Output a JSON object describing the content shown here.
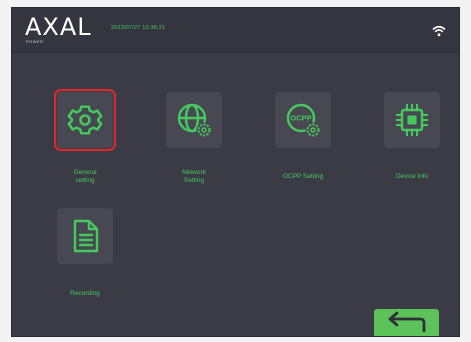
{
  "header": {
    "logo": "AXAL",
    "logo_sub": "POWER",
    "datetime": "2023/07/27 10:38:21",
    "wifi_icon": "wifi-icon"
  },
  "menu": {
    "items": [
      {
        "label": "General\nsetting",
        "icon": "gear-icon",
        "selected": true
      },
      {
        "label": "Network\nSetting",
        "icon": "globe-gear-icon",
        "selected": false
      },
      {
        "label": "OCPP Setting",
        "icon": "ocpp-gear-icon",
        "selected": false
      },
      {
        "label": "Device Info",
        "icon": "chip-icon",
        "selected": false
      },
      {
        "label": "Recording",
        "icon": "document-icon",
        "selected": false
      }
    ]
  },
  "back_button": {
    "icon": "back-arrow-icon"
  },
  "colors": {
    "accent": "#46c95c",
    "background": "#3a3b45",
    "tile": "#474852",
    "selection": "#e0272b",
    "button": "#5cc35a"
  }
}
